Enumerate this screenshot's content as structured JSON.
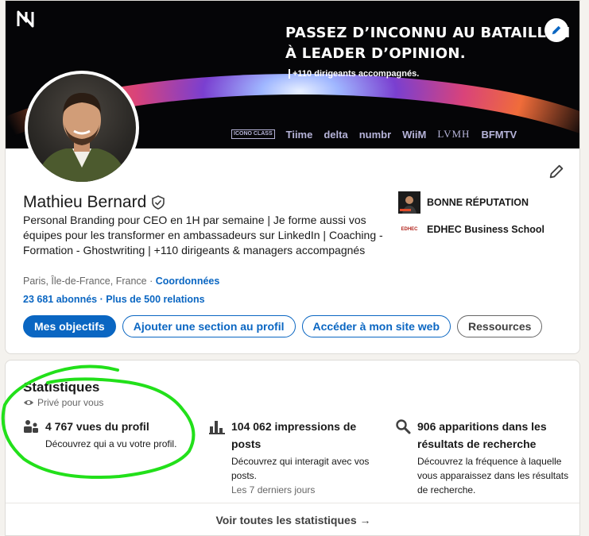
{
  "banner": {
    "headline_line1": "PASSEZ D’INCONNU AU BATAILLON",
    "headline_line2": "À LEADER D’OPINION.",
    "subline": "+110 dirigeants accompagnés.",
    "brands": [
      "ICONO CLASS",
      "Tiime",
      "delta",
      "numbr",
      "WiiM",
      "LVMH",
      "BFMTV"
    ]
  },
  "profile": {
    "name": "Mathieu Bernard",
    "headline": "Personal Branding pour CEO en 1H par semaine | Je forme aussi vos équipes pour les transformer en ambassadeurs sur LinkedIn | Coaching - Formation - Ghostwriting | +110 dirigeants & managers accompagnés",
    "location": "Paris, Île-de-France, France",
    "contact_link": "Coordonnées",
    "followers": "23 681 abonnés",
    "connections": "Plus de 500 relations",
    "separator": "·"
  },
  "side": {
    "company": "BONNE RÉPUTATION",
    "school": "EDHEC Business School",
    "school_logo_text": "EDHEC"
  },
  "actions": {
    "primary": "Mes objectifs",
    "add_section": "Ajouter une section au profil",
    "website": "Accéder à mon site web",
    "resources": "Ressources"
  },
  "stats": {
    "title": "Statistiques",
    "privacy": "Privé pour vous",
    "items": [
      {
        "value": "4 767 vues du profil",
        "desc": "Découvrez qui a vu votre profil.",
        "period": ""
      },
      {
        "value": "104 062 impressions de posts",
        "desc": "Découvrez qui interagit avec vos posts.",
        "period": "Les 7 derniers jours"
      },
      {
        "value": "906 apparitions dans les résultats de recherche",
        "desc": "Découvrez la fréquence à laquelle vous apparaissez dans les résultats de recherche.",
        "period": ""
      }
    ],
    "footer_link": "Voir toutes les statistiques →"
  },
  "colors": {
    "linkedin_blue": "#0a66c2",
    "annotation_green": "#22e01a"
  }
}
